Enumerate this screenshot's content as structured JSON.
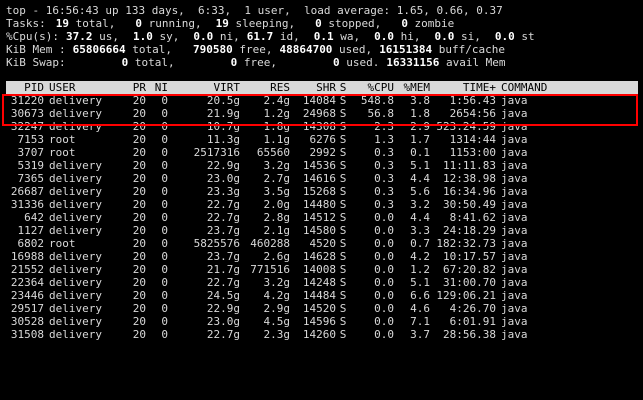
{
  "summary": {
    "line1": "top - 16:56:43 up 133 days,  6:33,  1 user,  load average: 1.65, 0.66, 0.37",
    "tasks": {
      "label": "Tasks:",
      "total": "19",
      "total_l": " total,",
      "running": "0",
      "running_l": " running,",
      "sleeping": "19",
      "sleeping_l": " sleeping,",
      "stopped": "0",
      "stopped_l": " stopped,",
      "zombie": "0",
      "zombie_l": " zombie"
    },
    "cpu": {
      "label": "%Cpu(s):",
      "us": "37.2",
      "us_l": " us,",
      "sy": "1.0",
      "sy_l": " sy,",
      "ni": "0.0",
      "ni_l": " ni,",
      "id": "61.7",
      "id_l": " id,",
      "wa": "0.1",
      "wa_l": " wa,",
      "hi": "0.0",
      "hi_l": " hi,",
      "si": "0.0",
      "si_l": " si,",
      "st": "0.0",
      "st_l": " st"
    },
    "mem": {
      "label": "KiB Mem :",
      "total": "65806664",
      "total_l": " total,",
      "free": "790580",
      "free_l": " free,",
      "used": "48864700",
      "used_l": " used,",
      "buff": "16151384",
      "buff_l": " buff/cache"
    },
    "swap": {
      "label": "KiB Swap:",
      "total": "0",
      "total_l": " total,",
      "free": "0",
      "free_l": " free,",
      "used": "0",
      "used_l": " used.",
      "avail": "16331156",
      "avail_l": " avail Mem"
    }
  },
  "columns": [
    "PID",
    "USER",
    "PR",
    "NI",
    "VIRT",
    "RES",
    "SHR",
    "S",
    "%CPU",
    "%MEM",
    "TIME+",
    "COMMAND"
  ],
  "processes": [
    [
      "31220",
      "delivery",
      "20",
      "0",
      "20.5g",
      "2.4g",
      "14084",
      "S",
      "548.8",
      "3.8",
      "1:56.43",
      "java"
    ],
    [
      "30673",
      "delivery",
      "20",
      "0",
      "21.9g",
      "1.2g",
      "24968",
      "S",
      "56.8",
      "1.8",
      "2654:56",
      "java"
    ],
    [
      "32247",
      "delivery",
      "20",
      "0",
      "10.7g",
      "1.8g",
      "14308",
      "S",
      "2.3",
      "2.9",
      "523:24.59",
      "java"
    ],
    [
      "7153",
      "root",
      "20",
      "0",
      "11.3g",
      "1.1g",
      "6276",
      "S",
      "1.3",
      "1.7",
      "1314:44",
      "java"
    ],
    [
      "3707",
      "root",
      "20",
      "0",
      "2517316",
      "65560",
      "2992",
      "S",
      "0.3",
      "0.1",
      "1153:00",
      "java"
    ],
    [
      "5319",
      "delivery",
      "20",
      "0",
      "22.9g",
      "3.2g",
      "14536",
      "S",
      "0.3",
      "5.1",
      "11:11.83",
      "java"
    ],
    [
      "7365",
      "delivery",
      "20",
      "0",
      "23.0g",
      "2.7g",
      "14616",
      "S",
      "0.3",
      "4.4",
      "12:38.98",
      "java"
    ],
    [
      "26687",
      "delivery",
      "20",
      "0",
      "23.3g",
      "3.5g",
      "15268",
      "S",
      "0.3",
      "5.6",
      "16:34.96",
      "java"
    ],
    [
      "31336",
      "delivery",
      "20",
      "0",
      "22.7g",
      "2.0g",
      "14480",
      "S",
      "0.3",
      "3.2",
      "30:50.49",
      "java"
    ],
    [
      "642",
      "delivery",
      "20",
      "0",
      "22.7g",
      "2.8g",
      "14512",
      "S",
      "0.0",
      "4.4",
      "8:41.62",
      "java"
    ],
    [
      "1127",
      "delivery",
      "20",
      "0",
      "23.7g",
      "2.1g",
      "14580",
      "S",
      "0.0",
      "3.3",
      "24:18.29",
      "java"
    ],
    [
      "6802",
      "root",
      "20",
      "0",
      "5825576",
      "460288",
      "4520",
      "S",
      "0.0",
      "0.7",
      "182:32.73",
      "java"
    ],
    [
      "16988",
      "delivery",
      "20",
      "0",
      "23.7g",
      "2.6g",
      "14628",
      "S",
      "0.0",
      "4.2",
      "10:17.57",
      "java"
    ],
    [
      "21552",
      "delivery",
      "20",
      "0",
      "21.7g",
      "771516",
      "14008",
      "S",
      "0.0",
      "1.2",
      "67:20.82",
      "java"
    ],
    [
      "22364",
      "delivery",
      "20",
      "0",
      "22.7g",
      "3.2g",
      "14248",
      "S",
      "0.0",
      "5.1",
      "31:00.70",
      "java"
    ],
    [
      "23446",
      "delivery",
      "20",
      "0",
      "24.5g",
      "4.2g",
      "14484",
      "S",
      "0.0",
      "6.6",
      "129:06.21",
      "java"
    ],
    [
      "29517",
      "delivery",
      "20",
      "0",
      "22.9g",
      "2.9g",
      "14520",
      "S",
      "0.0",
      "4.6",
      "4:26.70",
      "java"
    ],
    [
      "30528",
      "delivery",
      "20",
      "0",
      "23.0g",
      "4.5g",
      "14596",
      "S",
      "0.0",
      "7.1",
      "6:01.91",
      "java"
    ],
    [
      "31508",
      "delivery",
      "20",
      "0",
      "22.7g",
      "2.3g",
      "14260",
      "S",
      "0.0",
      "3.7",
      "28:56.38",
      "java"
    ]
  ]
}
